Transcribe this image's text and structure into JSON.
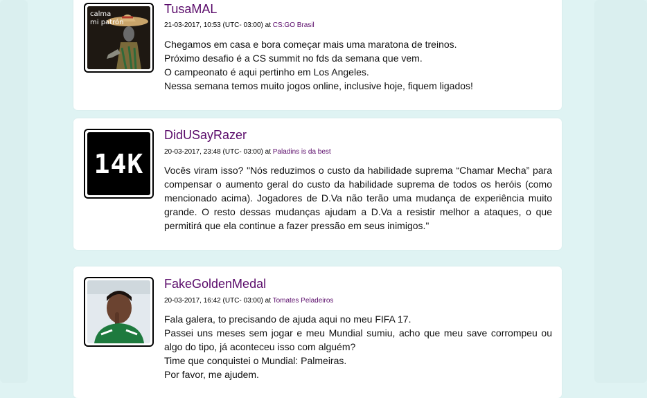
{
  "posts": [
    {
      "username": "TusaMAL",
      "meta_prefix": "21-03-2017, 10:53 (UTC- 03:00) at ",
      "group": "CS:GO Brasil",
      "avatar_caption_line1": "calma",
      "avatar_caption_line2": "mi patrón",
      "lines": [
        "Chegamos em casa e bora começar mais uma maratona de treinos.",
        "Próximo desafio é a CS summit no fds da semana que vem.",
        "O campeonato é aqui pertinho em Los Angeles.",
        "Nessa semana temos muito jogos online, inclusive hoje, fiquem ligados!"
      ]
    },
    {
      "username": "DidUSayRazer",
      "meta_prefix": "20-03-2017, 23:48 (UTC- 03:00) at ",
      "group": "Paladins is da best",
      "avatar_text": "14K",
      "paragraph": "Vocês viram isso? \"Nós reduzimos o custo da habilidade suprema “Chamar Mecha” para compensar o aumento geral do custo da habilidade suprema de todos os heróis (como mencionado acima). Jogadores de D.Va não terão uma mudança de experiência muito grande. O resto dessas mudanças ajudam a D.Va a resistir melhor a ataques, o que permitirá que ela continue a fazer pressão em seus inimigos.\""
    },
    {
      "username": "FakeGoldenMedal",
      "meta_prefix": "20-03-2017, 16:42 (UTC- 03:00) at ",
      "group": "Tomates Peladeiros",
      "line1": "Fala galera, to precisando de ajuda aqui no meu FIFA 17.",
      "paragraph": "Passei uns meses sem jogar e meu Mundial sumiu, acho que meu save corrompeu ou algo do tipo, já aconteceu isso com alguém?",
      "line3": "Time que conquistei o Mundial: Palmeiras.",
      "line4": "Por favor, me ajudem."
    }
  ]
}
